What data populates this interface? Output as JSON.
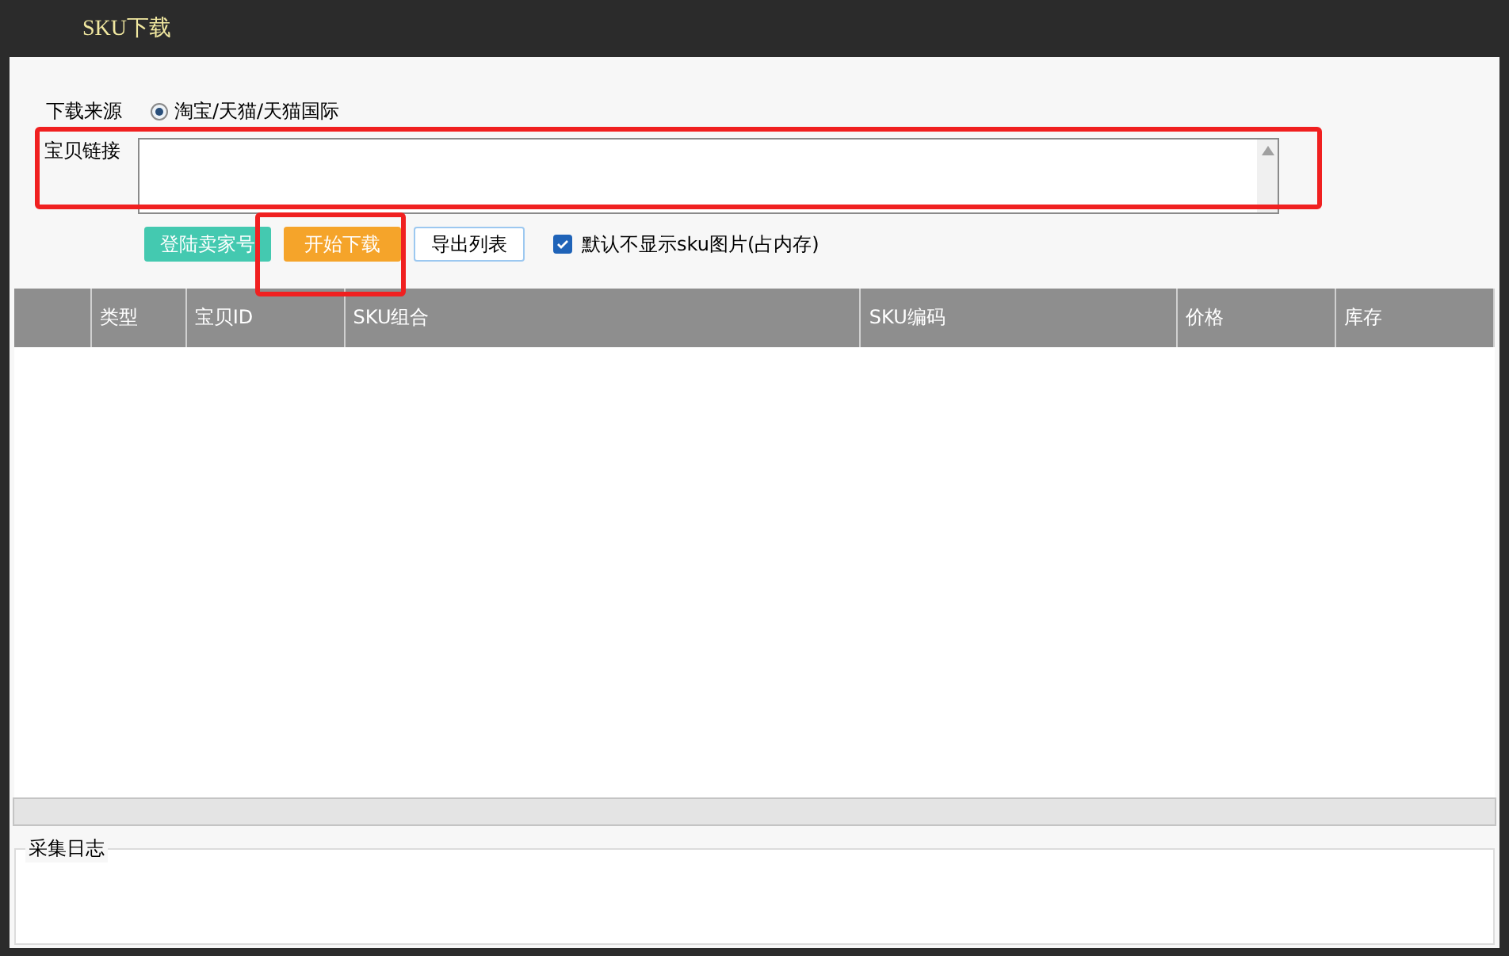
{
  "window": {
    "title": "SKU下载"
  },
  "source": {
    "label": "下载来源",
    "options": [
      {
        "label": "淘宝/天猫/天猫国际",
        "selected": true
      }
    ]
  },
  "link": {
    "label": "宝贝链接"
  },
  "buttons": [
    {
      "label": "登陆卖家号",
      "kind": "teal"
    },
    {
      "label": "开始下载",
      "kind": "orange"
    },
    {
      "label": "导出列表",
      "kind": "plain"
    }
  ],
  "hide_images": {
    "label": "默认不显示sku图片(占内存)",
    "checked": true
  },
  "table": {
    "columns": [
      "类型",
      "宝贝ID",
      "SKU组合",
      "SKU编码",
      "价格",
      "库存"
    ]
  },
  "log": {
    "title": "采集日志"
  }
}
